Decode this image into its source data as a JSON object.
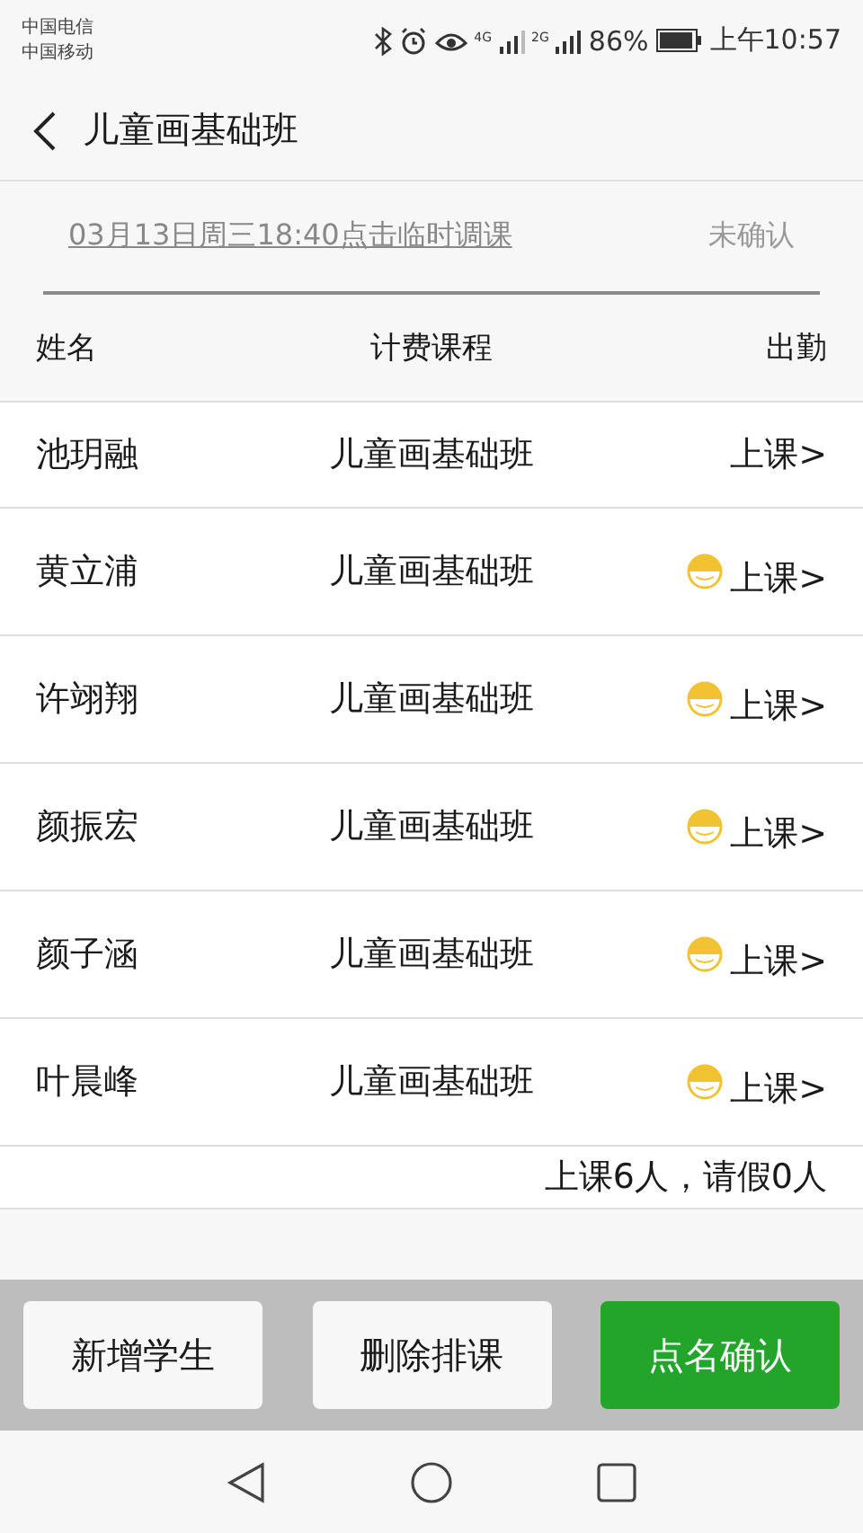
{
  "status_bar": {
    "carriers": [
      "中国电信",
      "中国移动"
    ],
    "network_1": "4G",
    "network_2": "2G",
    "battery": "86%",
    "time": "上午10:57"
  },
  "header": {
    "title": "儿童画基础班"
  },
  "schedule": {
    "link": "03月13日周三18:40点击临时调课",
    "status": "未确认"
  },
  "table": {
    "columns": [
      "姓名",
      "计费课程",
      "出勤"
    ],
    "rows": [
      {
        "name": "池玥融",
        "course": "儿童画基础班",
        "status_icon": false,
        "attendance": "上课>"
      },
      {
        "name": "黄立浦",
        "course": "儿童画基础班",
        "status_icon": true,
        "attendance": "上课>"
      },
      {
        "name": "许翊翔",
        "course": "儿童画基础班",
        "status_icon": true,
        "attendance": "上课>"
      },
      {
        "name": "颜振宏",
        "course": "儿童画基础班",
        "status_icon": true,
        "attendance": "上课>"
      },
      {
        "name": "颜子涵",
        "course": "儿童画基础班",
        "status_icon": true,
        "attendance": "上课>"
      },
      {
        "name": "叶晨峰",
        "course": "儿童画基础班",
        "status_icon": true,
        "attendance": "上课>"
      }
    ]
  },
  "summary": "上课6人，请假0人",
  "buttons": [
    {
      "label": "新增学生",
      "kind": "plain"
    },
    {
      "label": "删除排课",
      "kind": "plain"
    },
    {
      "label": "点名确认",
      "kind": "primary"
    }
  ]
}
